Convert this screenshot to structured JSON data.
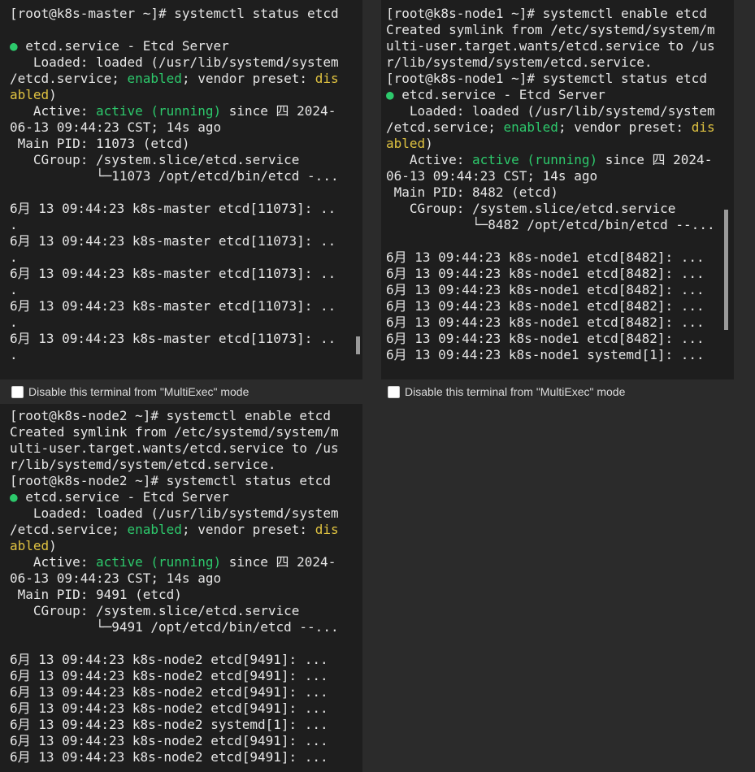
{
  "panes": {
    "master": {
      "lines": [
        [
          {
            "t": "[root@k8s-master ~]# systemctl status etcd"
          }
        ],
        [
          {
            "t": ""
          }
        ],
        [
          {
            "t": "● ",
            "c": "g"
          },
          {
            "t": "etcd.service - Etcd Server"
          }
        ],
        [
          {
            "t": "   Loaded: loaded (/usr/lib/systemd/system"
          }
        ],
        [
          {
            "t": "/etcd.service; "
          },
          {
            "t": "enabled",
            "c": "g"
          },
          {
            "t": "; vendor preset: "
          },
          {
            "t": "dis",
            "c": "y"
          }
        ],
        [
          {
            "t": "abled",
            "c": "y"
          },
          {
            "t": ")"
          }
        ],
        [
          {
            "t": "   Active: "
          },
          {
            "t": "active (running)",
            "c": "g"
          },
          {
            "t": " since 四 2024-"
          }
        ],
        [
          {
            "t": "06-13 09:44:23 CST; 14s ago"
          }
        ],
        [
          {
            "t": " Main PID: 11073 (etcd)"
          }
        ],
        [
          {
            "t": "   CGroup: /system.slice/etcd.service"
          }
        ],
        [
          {
            "t": "           └─11073 /opt/etcd/bin/etcd -..."
          }
        ],
        [
          {
            "t": ""
          }
        ],
        [
          {
            "t": "6月 13 09:44:23 k8s-master etcd[11073]: .."
          }
        ],
        [
          {
            "t": "."
          }
        ],
        [
          {
            "t": "6月 13 09:44:23 k8s-master etcd[11073]: .."
          }
        ],
        [
          {
            "t": "."
          }
        ],
        [
          {
            "t": "6月 13 09:44:23 k8s-master etcd[11073]: .."
          }
        ],
        [
          {
            "t": "."
          }
        ],
        [
          {
            "t": "6月 13 09:44:23 k8s-master etcd[11073]: .."
          }
        ],
        [
          {
            "t": "."
          }
        ],
        [
          {
            "t": "6月 13 09:44:23 k8s-master etcd[11073]: .."
          }
        ],
        [
          {
            "t": "."
          }
        ]
      ],
      "multiexec_label": "Disable this terminal from \"MultiExec\" mode"
    },
    "node1": {
      "lines": [
        [
          {
            "t": "[root@k8s-node1 ~]# systemctl enable etcd"
          }
        ],
        [
          {
            "t": "Created symlink from /etc/systemd/system/m"
          }
        ],
        [
          {
            "t": "ulti-user.target.wants/etcd.service to /us"
          }
        ],
        [
          {
            "t": "r/lib/systemd/system/etcd.service."
          }
        ],
        [
          {
            "t": "[root@k8s-node1 ~]# systemctl status etcd"
          }
        ],
        [
          {
            "t": "● ",
            "c": "g"
          },
          {
            "t": "etcd.service - Etcd Server"
          }
        ],
        [
          {
            "t": "   Loaded: loaded (/usr/lib/systemd/system"
          }
        ],
        [
          {
            "t": "/etcd.service; "
          },
          {
            "t": "enabled",
            "c": "g"
          },
          {
            "t": "; vendor preset: "
          },
          {
            "t": "dis",
            "c": "y"
          }
        ],
        [
          {
            "t": "abled",
            "c": "y"
          },
          {
            "t": ")"
          }
        ],
        [
          {
            "t": "   Active: "
          },
          {
            "t": "active (running)",
            "c": "g"
          },
          {
            "t": " since 四 2024-"
          }
        ],
        [
          {
            "t": "06-13 09:44:23 CST; 14s ago"
          }
        ],
        [
          {
            "t": " Main PID: 8482 (etcd)"
          }
        ],
        [
          {
            "t": "   CGroup: /system.slice/etcd.service"
          }
        ],
        [
          {
            "t": "           └─8482 /opt/etcd/bin/etcd --..."
          }
        ],
        [
          {
            "t": ""
          }
        ],
        [
          {
            "t": "6月 13 09:44:23 k8s-node1 etcd[8482]: ..."
          }
        ],
        [
          {
            "t": "6月 13 09:44:23 k8s-node1 etcd[8482]: ..."
          }
        ],
        [
          {
            "t": "6月 13 09:44:23 k8s-node1 etcd[8482]: ..."
          }
        ],
        [
          {
            "t": "6月 13 09:44:23 k8s-node1 etcd[8482]: ..."
          }
        ],
        [
          {
            "t": "6月 13 09:44:23 k8s-node1 etcd[8482]: ..."
          }
        ],
        [
          {
            "t": "6月 13 09:44:23 k8s-node1 etcd[8482]: ..."
          }
        ],
        [
          {
            "t": "6月 13 09:44:23 k8s-node1 systemd[1]: ..."
          }
        ]
      ],
      "multiexec_label": "Disable this terminal from \"MultiExec\" mode"
    },
    "node2": {
      "lines": [
        [
          {
            "t": "[root@k8s-node2 ~]# systemctl enable etcd"
          }
        ],
        [
          {
            "t": "Created symlink from /etc/systemd/system/m"
          }
        ],
        [
          {
            "t": "ulti-user.target.wants/etcd.service to /us"
          }
        ],
        [
          {
            "t": "r/lib/systemd/system/etcd.service."
          }
        ],
        [
          {
            "t": "[root@k8s-node2 ~]# systemctl status etcd"
          }
        ],
        [
          {
            "t": "● ",
            "c": "g"
          },
          {
            "t": "etcd.service - Etcd Server"
          }
        ],
        [
          {
            "t": "   Loaded: loaded (/usr/lib/systemd/system"
          }
        ],
        [
          {
            "t": "/etcd.service; "
          },
          {
            "t": "enabled",
            "c": "g"
          },
          {
            "t": "; vendor preset: "
          },
          {
            "t": "dis",
            "c": "y"
          }
        ],
        [
          {
            "t": "abled",
            "c": "y"
          },
          {
            "t": ")"
          }
        ],
        [
          {
            "t": "   Active: "
          },
          {
            "t": "active (running)",
            "c": "g"
          },
          {
            "t": " since 四 2024-"
          }
        ],
        [
          {
            "t": "06-13 09:44:23 CST; 14s ago"
          }
        ],
        [
          {
            "t": " Main PID: 9491 (etcd)"
          }
        ],
        [
          {
            "t": "   CGroup: /system.slice/etcd.service"
          }
        ],
        [
          {
            "t": "           └─9491 /opt/etcd/bin/etcd --..."
          }
        ],
        [
          {
            "t": ""
          }
        ],
        [
          {
            "t": "6月 13 09:44:23 k8s-node2 etcd[9491]: ..."
          }
        ],
        [
          {
            "t": "6月 13 09:44:23 k8s-node2 etcd[9491]: ..."
          }
        ],
        [
          {
            "t": "6月 13 09:44:23 k8s-node2 etcd[9491]: ..."
          }
        ],
        [
          {
            "t": "6月 13 09:44:23 k8s-node2 etcd[9491]: ..."
          }
        ],
        [
          {
            "t": "6月 13 09:44:23 k8s-node2 systemd[1]: ..."
          }
        ],
        [
          {
            "t": "6月 13 09:44:23 k8s-node2 etcd[9491]: ..."
          }
        ],
        [
          {
            "t": "6月 13 09:44:23 k8s-node2 etcd[9491]: ..."
          }
        ]
      ]
    }
  },
  "colors": {
    "terminal_bg": "#1e1e1e",
    "text": "#e6e6e6",
    "green": "#2dc96c",
    "yellow": "#e0c341",
    "chrome": "#2b2b2b"
  }
}
